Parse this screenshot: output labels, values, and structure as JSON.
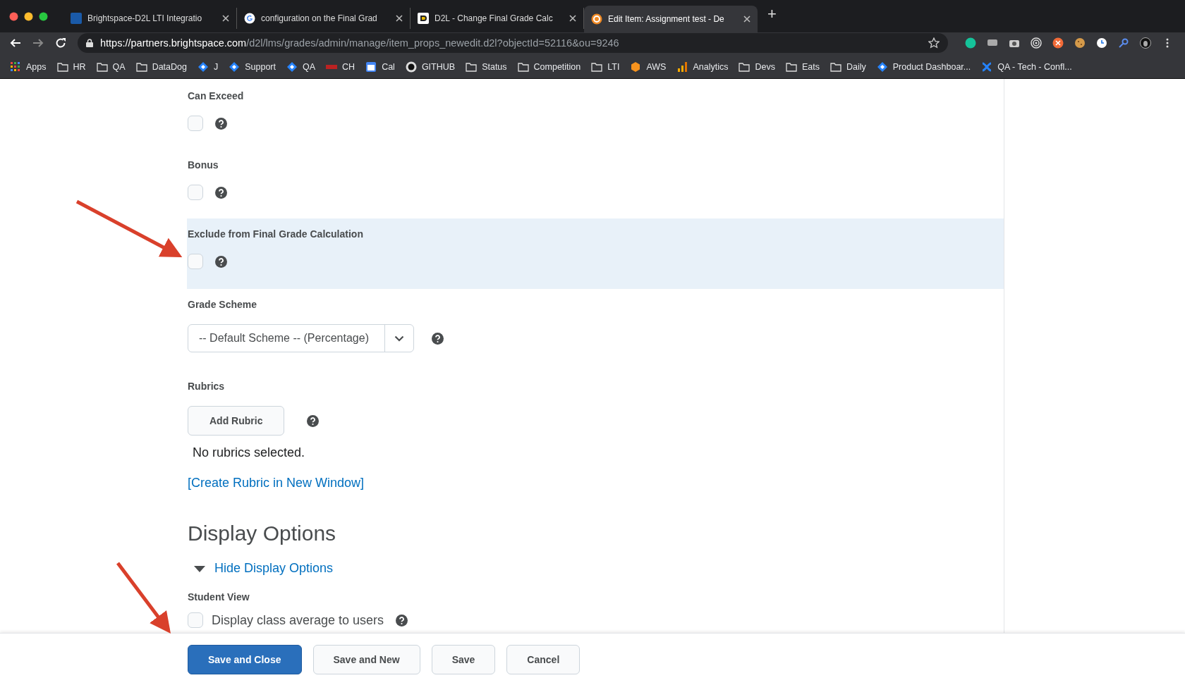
{
  "browser": {
    "tabs": [
      {
        "title": "Brightspace-D2L LTI Integratio",
        "selected": false
      },
      {
        "title": "configuration on the Final Grad",
        "selected": false
      },
      {
        "title": "D2L - Change Final Grade Calc",
        "selected": false
      },
      {
        "title": "Edit Item: Assignment test - De",
        "selected": true
      }
    ],
    "new_tab": "+",
    "url": {
      "host": "https://partners.brightspace.com",
      "path": "/d2l/lms/grades/admin/manage/item_props_newedit.d2l?objectId=52116&ou=9246"
    },
    "bookmarks": [
      {
        "label": "Apps",
        "kind": "apps"
      },
      {
        "label": "HR",
        "kind": "folder"
      },
      {
        "label": "QA",
        "kind": "folder"
      },
      {
        "label": "DataDog",
        "kind": "folder"
      },
      {
        "label": "J",
        "kind": "jira"
      },
      {
        "label": "Support",
        "kind": "jira"
      },
      {
        "label": "QA",
        "kind": "jira"
      },
      {
        "label": "CH",
        "kind": "ch"
      },
      {
        "label": "Cal",
        "kind": "cal"
      },
      {
        "label": "GITHUB",
        "kind": "github"
      },
      {
        "label": "Status",
        "kind": "folder"
      },
      {
        "label": "Competition",
        "kind": "folder"
      },
      {
        "label": "LTI",
        "kind": "folder"
      },
      {
        "label": "AWS",
        "kind": "aws"
      },
      {
        "label": "Analytics",
        "kind": "analytics"
      },
      {
        "label": "Devs",
        "kind": "folder"
      },
      {
        "label": "Eats",
        "kind": "folder"
      },
      {
        "label": "Daily",
        "kind": "folder"
      },
      {
        "label": "Product Dashboar...",
        "kind": "jira"
      },
      {
        "label": "QA - Tech - Confl...",
        "kind": "confluence"
      }
    ]
  },
  "form": [
    {
      "kind": "checkbox",
      "label": "Can Exceed",
      "checked": false,
      "highlighted": false
    },
    {
      "kind": "checkbox",
      "label": "Bonus",
      "checked": false,
      "highlighted": false
    },
    {
      "kind": "checkbox",
      "label": "Exclude from Final Grade Calculation",
      "checked": false,
      "highlighted": true
    },
    {
      "kind": "select",
      "label": "Grade Scheme",
      "value": "-- Default Scheme -- (Percentage)"
    },
    {
      "kind": "rubrics",
      "label": "Rubrics",
      "button": "Add Rubric",
      "empty_text": "No rubrics selected.",
      "link": "[Create Rubric in New Window]"
    },
    {
      "kind": "heading",
      "label": "Display Options"
    },
    {
      "kind": "toggle",
      "label": "Hide Display Options",
      "expanded": true
    },
    {
      "kind": "group",
      "label": "Student View",
      "items": [
        {
          "label": "Display class average to users",
          "checked": false
        }
      ]
    }
  ],
  "footer": [
    {
      "label": "Save and Close",
      "primary": true
    },
    {
      "label": "Save and New",
      "primary": false
    },
    {
      "label": "Save",
      "primary": false
    },
    {
      "label": "Cancel",
      "primary": false
    }
  ]
}
